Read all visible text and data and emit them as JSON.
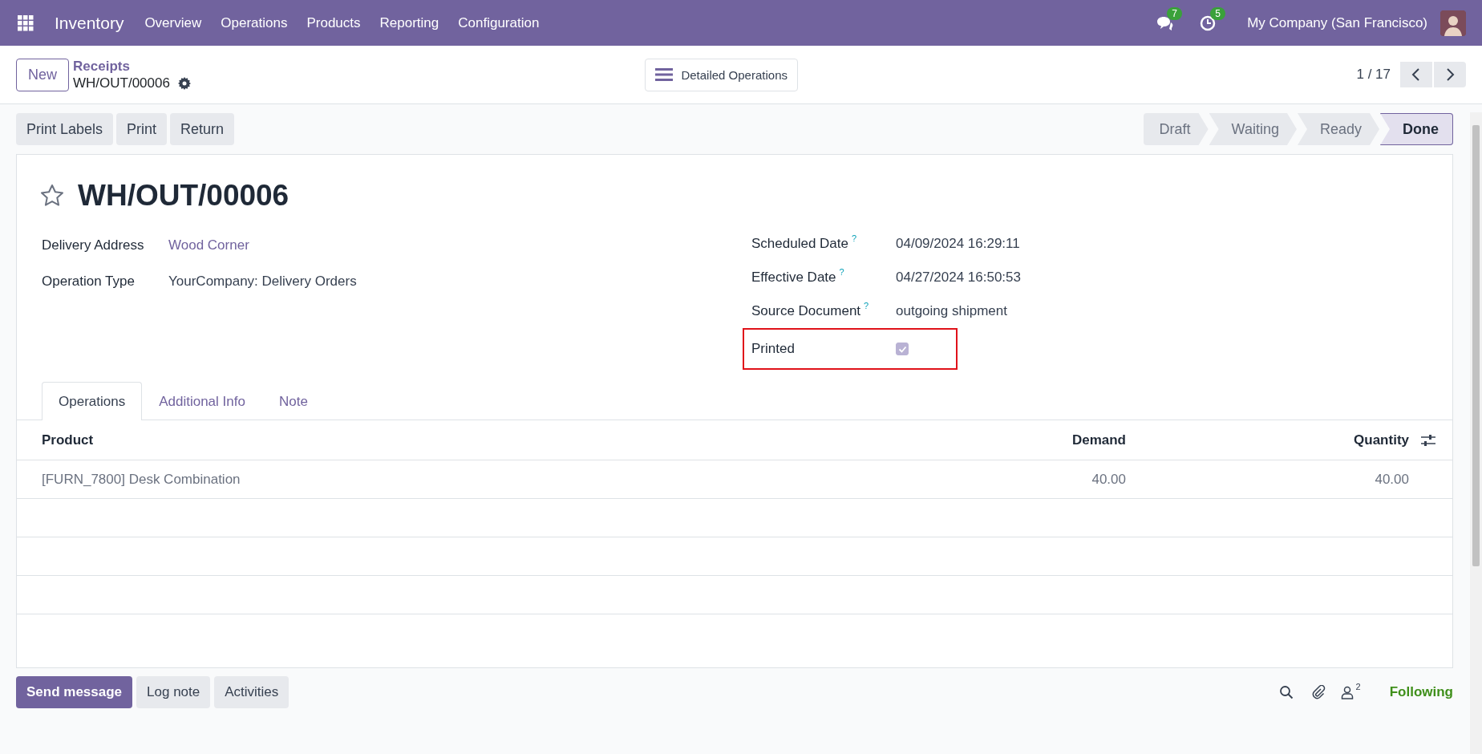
{
  "navbar": {
    "app_name": "Inventory",
    "menu": [
      "Overview",
      "Operations",
      "Products",
      "Reporting",
      "Configuration"
    ],
    "messages_count": "7",
    "activities_count": "5",
    "company": "My Company (San Francisco)"
  },
  "control_panel": {
    "new_button": "New",
    "breadcrumb_parent": "Receipts",
    "breadcrumb_current": "WH/OUT/00006",
    "detailed_operations": "Detailed Operations",
    "pager": "1 / 17"
  },
  "action_buttons": [
    "Print Labels",
    "Print",
    "Return"
  ],
  "statusbar": [
    {
      "label": "Draft",
      "selected": false
    },
    {
      "label": "Waiting",
      "selected": false
    },
    {
      "label": "Ready",
      "selected": false
    },
    {
      "label": "Done",
      "selected": true
    }
  ],
  "form": {
    "title": "WH/OUT/00006",
    "starred": false,
    "left_fields": [
      {
        "label": "Delivery Address",
        "value": "Wood Corner",
        "kind": "link"
      },
      {
        "label": "Operation Type",
        "value": "YourCompany: Delivery Orders",
        "kind": "text"
      }
    ],
    "right_fields": [
      {
        "label": "Scheduled Date",
        "help": "?",
        "value": "04/09/2024 16:29:11"
      },
      {
        "label": "Effective Date",
        "help": "?",
        "value": "04/27/2024 16:50:53"
      },
      {
        "label": "Source Document",
        "help": "?",
        "value": "outgoing shipment"
      }
    ],
    "printed": {
      "label": "Printed",
      "checked": true,
      "highlighted": true
    }
  },
  "tabs": [
    {
      "label": "Operations",
      "selected": true
    },
    {
      "label": "Additional Info",
      "selected": false
    },
    {
      "label": "Note",
      "selected": false
    }
  ],
  "table": {
    "columns": [
      "Product",
      "Demand",
      "Quantity"
    ],
    "rows": [
      {
        "product": "[FURN_7800] Desk Combination",
        "demand": "40.00",
        "quantity": "40.00"
      }
    ]
  },
  "chatter": {
    "buttons": [
      {
        "label": "Send message",
        "kind": "primary"
      },
      {
        "label": "Log note",
        "kind": "secondary"
      },
      {
        "label": "Activities",
        "kind": "secondary"
      }
    ],
    "followers_count": "2",
    "following": "Following"
  }
}
